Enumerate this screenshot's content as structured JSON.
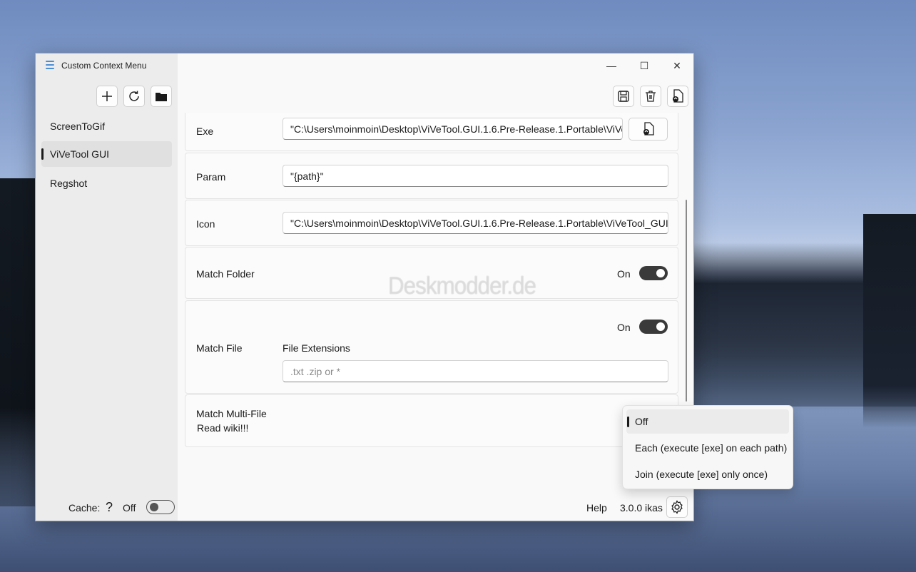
{
  "app": {
    "title": "Custom Context Menu"
  },
  "window_controls": {
    "minimize": "—",
    "maximize": "☐",
    "close": "✕"
  },
  "sidebar": {
    "toolbar": [
      {
        "name": "add-icon",
        "glyph": "+"
      },
      {
        "name": "refresh-icon",
        "glyph": "⟳"
      },
      {
        "name": "folder-icon",
        "glyph": "📁"
      }
    ],
    "items": [
      {
        "label": "ScreenToGif"
      },
      {
        "label": "ViVeTool GUI",
        "selected": true
      },
      {
        "label": "Regshot"
      }
    ],
    "cache": {
      "label": "Cache:",
      "help": "?",
      "state": "Off"
    }
  },
  "main": {
    "toolbar": [
      {
        "name": "save-icon"
      },
      {
        "name": "delete-icon"
      },
      {
        "name": "open-file-icon"
      }
    ],
    "fields": {
      "exe": {
        "label": "Exe",
        "value": "\"C:\\Users\\moinmoin\\Desktop\\ViVeTool.GUI.1.6.Pre-Release.1.Portable\\ViVe"
      },
      "param": {
        "label": "Param",
        "value": "\"{path}\""
      },
      "icon": {
        "label": "Icon",
        "value": "\"C:\\Users\\moinmoin\\Desktop\\ViVeTool.GUI.1.6.Pre-Release.1.Portable\\ViVeTool_GUI.e"
      },
      "match_folder": {
        "label": "Match Folder",
        "state": "On"
      },
      "match_file": {
        "label": "Match File",
        "state": "On",
        "ext_label": "File Extensions",
        "ext_placeholder": ".txt .zip  or *"
      },
      "match_multi": {
        "label": "Match Multi-File",
        "sublabel": "Read wiki!!!"
      }
    },
    "footer": {
      "help": "Help",
      "version": "3.0.0 ikas"
    }
  },
  "dropdown": {
    "options": [
      {
        "label": "Off",
        "selected": true
      },
      {
        "label": "Each (execute [exe] on each path)"
      },
      {
        "label": "Join (execute [exe] only once)"
      }
    ]
  },
  "watermark": "Deskmodder.de"
}
